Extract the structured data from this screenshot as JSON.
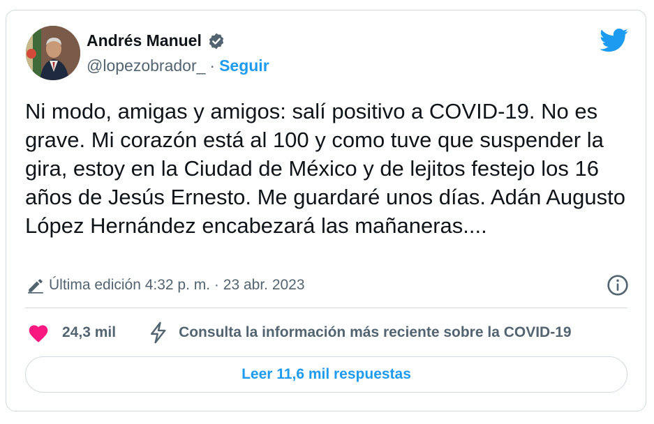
{
  "author": {
    "display_name": "Andrés Manuel",
    "handle": "@lopezobrador_",
    "separator": "·",
    "follow_label": "Seguir",
    "verified_icon": "verified-badge-icon"
  },
  "tweet": {
    "text": "Ni modo, amigas y amigos: salí positivo a COVID-19. No es grave. Mi corazón está al 100 y como tuve que suspender la gira, estoy en la Ciudad de México y de lejitos festejo los 16 años de Jesús Ernesto. Me guardaré unos días. Adán Augusto López Hernández encabezará las mañaneras...."
  },
  "meta": {
    "edited_label": "Última edición 4:32 p. m. · 23 abr. 2023"
  },
  "actions": {
    "like_count": "24,3 mil",
    "covid_info": "Consulta la información más reciente sobre la COVID-19",
    "read_replies": "Leer 11,6 mil respuestas"
  },
  "colors": {
    "accent": "#1d9bf0",
    "heart": "#f91880",
    "secondary_text": "#536471",
    "border": "#cfd9de"
  }
}
